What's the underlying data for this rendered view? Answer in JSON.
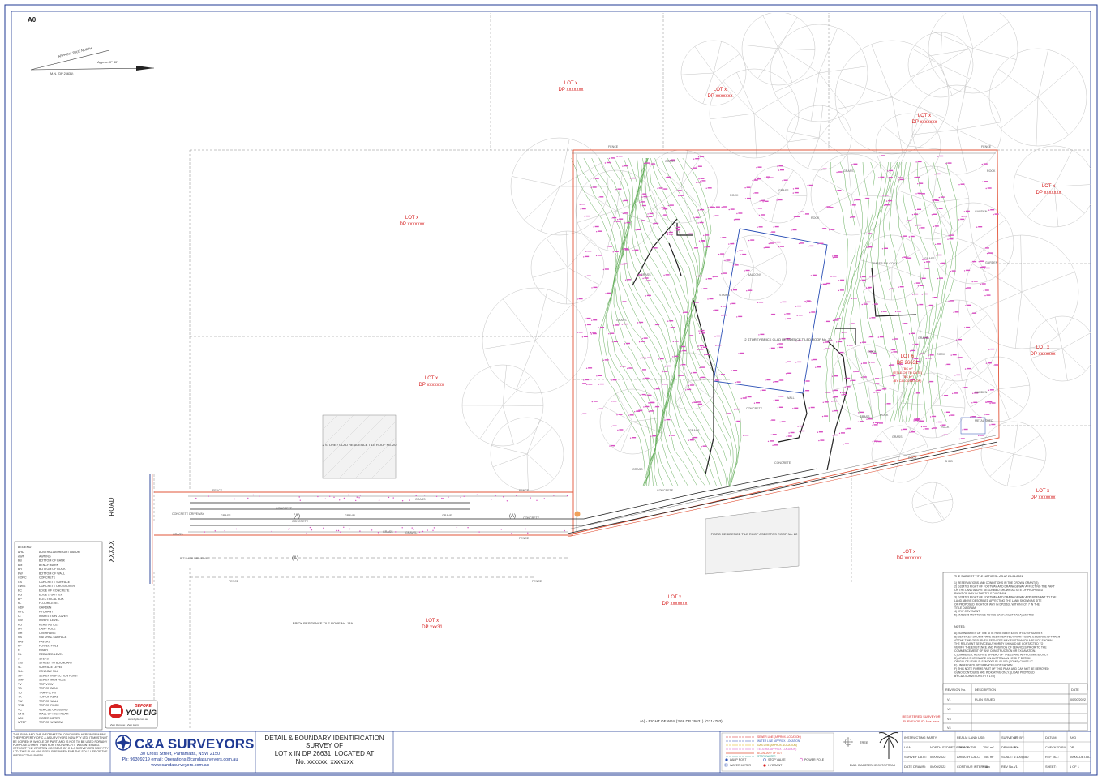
{
  "sheet": {
    "size_label": "A0",
    "north_label": "APPROX. TRUE NORTH",
    "north_note": "Approx. 0° 30'",
    "mgn_label": "M.N. (DP 26631)"
  },
  "road": {
    "name_top": "ROAD",
    "name_side": "XXXXX"
  },
  "lots": [
    {
      "lot": "LOT x",
      "dp": "DP xxxxxxx"
    },
    {
      "lot": "LOT x",
      "dp": "DP xxxxxxx"
    },
    {
      "lot": "LOT x",
      "dp": "DP xxxxxxx"
    },
    {
      "lot": "LOT x",
      "dp": "DP xxxxxxx"
    },
    {
      "lot": "LOT x",
      "dp": "DP xxxxxxx"
    },
    {
      "lot": "LOT x",
      "dp": "DP xxxxxxx"
    },
    {
      "lot": "LOT x",
      "dp": "DP xxxxxxx"
    },
    {
      "lot": "LOT x",
      "dp": "DP xxxxxxx"
    },
    {
      "lot": "LOT x",
      "dp": "DP xxxxxxx"
    },
    {
      "lot": "LOT x",
      "dp": "DP xxx31"
    }
  ],
  "subject_lot": {
    "lot": "LOT 6",
    "dp": "DP 26631",
    "area_line1": "TBC m²",
    "area_line2": "(TITLE OF TO DATE)",
    "area_line3": "TBC m²",
    "area_line4": "(BY CALCULATION)"
  },
  "map_labels": {
    "main_house": "2 STOREY BRICK CLAD RESIDENCE TILED ROOF No. 20",
    "west_house": "2 STOREY CLAD RESIDENCE TILE ROOF No. 20",
    "south_house": "BRICK RESIDENCE TILE ROOF No. 18A",
    "east_house": "FIBRO RESIDENCE TILE ROOF ASBESTOS ROOF No. 22",
    "gravel": "GRAVEL",
    "concrete": "CONCRETE",
    "grass": "GRASS",
    "fence": "FENCE",
    "rock": "ROCK",
    "stairs": "STAIRS",
    "wall": "WALL",
    "balcony": "BALCONY",
    "garden": "GARDEN",
    "shed": "SHED",
    "metal_shed": "METAL SHED",
    "timber_balcony": "TIMBER BALCONY",
    "concrete_driveway": "CONCRETE DRIVEWAY",
    "bitumen_driveway": "BITUMEN DRIVEWAY",
    "row_a": "(A)",
    "row_note": "(A) - RIGHT OF WAY (3.66 DP 26631) (G314703)"
  },
  "legend": {
    "title": "LEGEND",
    "rows": [
      [
        "AHD",
        "AUSTRALIAN HEIGHT DATUM"
      ],
      [
        "AWN",
        "AWNING"
      ],
      [
        "BB",
        "BOTTOM OF BANK"
      ],
      [
        "BM",
        "BENCH MARK"
      ],
      [
        "BR",
        "BOTTOM OF ROCK"
      ],
      [
        "BW",
        "BOTTOM OF WALL"
      ],
      [
        "CONC",
        "CONCRETE"
      ],
      [
        "CS",
        "CONCRETE SURFACE"
      ],
      [
        "CW/S",
        "CONCRETE CROSSOVER"
      ],
      [
        "EC",
        "EDGE OF CONCRETE"
      ],
      [
        "EG",
        "EDGE & GUTTER"
      ],
      [
        "EP",
        "ELECTRICAL BOX"
      ],
      [
        "FL",
        "FLOOR LEVEL"
      ],
      [
        "GDN",
        "GARDEN"
      ],
      [
        "HYD",
        "HYDRANT"
      ],
      [
        "IC",
        "INSPECTION COVER"
      ],
      [
        "INV",
        "INVERT LEVEL"
      ],
      [
        "KO",
        "KERB OUTLET"
      ],
      [
        "LH",
        "LAMP HOLE"
      ],
      [
        "OH",
        "OVERHANG"
      ],
      [
        "NS",
        "NATURAL SURFACE"
      ],
      [
        "PAV",
        "PAVERS"
      ],
      [
        "PP",
        "POWER POLE"
      ],
      [
        "R",
        "RISER"
      ],
      [
        "RL",
        "REDUCED LEVEL"
      ],
      [
        "S",
        "STEPS"
      ],
      [
        "S.B",
        "STREET TO BOUNDARY"
      ],
      [
        "SL",
        "SURFACE LEVEL"
      ],
      [
        "SLL",
        "WINDOW SILL"
      ],
      [
        "SIP",
        "SEWER INSPECTION POINT"
      ],
      [
        "SMH",
        "SEWER MAN HOLE"
      ],
      [
        "TV",
        "TOP VIEW"
      ],
      [
        "TB",
        "TOP OF BANK"
      ],
      [
        "TD",
        "TRAFFIC PIT"
      ],
      [
        "TK",
        "TOP OF KERB"
      ],
      [
        "TW",
        "TOP OF WALL"
      ],
      [
        "TRB",
        "TOP OF ROCK"
      ],
      [
        "VC",
        "VEHICLE CROSSING"
      ],
      [
        "WHB",
        "WALL OF HIGH NEAR"
      ],
      [
        "WM",
        "WATER METER"
      ],
      [
        "WTDP",
        "TOP OF WINDOW"
      ]
    ]
  },
  "notes": {
    "title_notes_header": "THE SUBJECT TITLE NOTICES - AS AT 23-04-2021",
    "title_notes": [
      "1) RESERVATIONS AND CONDITIONS IN THE CROWN GRANT(S)",
      "2) G314703 RIGHT OF FOOTWAY AND DRAINAGEWAY AFFECTING THE PART",
      "   OF THE LAND ABOVE DESCRIBED SHOWN AS SITE OF PROPOSED",
      "   RIGHT OF WAY IN THE TITLE DIAGRAM",
      "3) G314703 RIGHT OF FOOTWAY AND DRAINAGEWAY APPURTENANT TO THE",
      "   LAND ABOVE DESCRIBED AFFECTING THE LAND SHOWN AS SITE",
      "   OF PROPOSED RIGHT OF WAY IN DP26631 WITHIN LOT 7 IN THE",
      "   TITLE DIAGRAM",
      "4) 0747 COVENANT",
      "5) AM12345 MORTGAGE TO ING BANK (AUSTRALIA) LIMITED"
    ],
    "notes_header": "NOTES:",
    "notes": [
      "A) BOUNDARIES OF THE SITE HAVE BEEN IDENTIFIED BY SURVEY.",
      "B) SERVICES SHOWN HAVE BEEN DERIVED FROM VISUAL EVIDENCE APPARENT",
      "   AT THE TIME OF SURVEY. SERVICES MAY EXIST WHICH ARE NOT SHOWN.",
      "   THE RELEVANT SERVICE AUTHORITY SHOULD BE CONTACTED TO",
      "   VERIFY THE EXISTENCE AND POSITION OF SERVICES PRIOR TO THE",
      "   COMMENCEMENT OF ANY CONSTRUCTION OR EXCAVATION.",
      "C) DIAMETER, HEIGHT & SPREAD OF TREES ARE APPROXIMATE ONLY.",
      "D) LEVELS SHOWN ARE ON AUSTRALIAN HEIGHT DATUM",
      "   ORIGIN OF LEVELS: SSM 0000 RL 00.000 (SCIMS) CLASS LC",
      "E) UNDERGROUND SERVICES NOT SHOWN",
      "F) THIS NOTE FORMS PART OF THIS PLAN AND CAN NOT BE REMOVED",
      "G) NO CONTOURS ARE INDICATIVE ONLY. (LIDAR PROVIDED",
      "   BY C&A SURVEYORS PTY LTD)"
    ]
  },
  "revisions": {
    "headers": [
      "REVISION No.",
      "DESCRIPTION",
      "DATE"
    ],
    "rows": [
      [
        "V1",
        "PLAN ISSUED",
        "00/00/2022"
      ],
      [
        "V2",
        "",
        ""
      ],
      [
        "V3",
        "",
        ""
      ],
      [
        "V4",
        "",
        ""
      ]
    ]
  },
  "surveyor_sig": {
    "line1": "REGISTERED SURVEYOR",
    "line2": "SURVEYOR ID: Nos. xxxx"
  },
  "byd": {
    "top": "BEFORE",
    "main": "YOU DIG",
    "url": "www.byda.com.au",
    "tag": "Zero Damage • Zero Harm"
  },
  "company": {
    "disclaimer": "THIS PLAN AND THE INFORMATION CONTAINED HEREIN REMAINS THE PROPERTY OF C & A SURVEYORS NSW PTY LTD. IT MUST NOT BE COPIED IN WHOLE OR PART. AND IS NOT TO BE USED FOR ANY PURPOSE OTHER THAN FOR THAT WHICH IT WAS INTENDED. WITHOUT THE WRITTEN CONSENT OF C & A SURVEYORS NSW PTY LTD. THIS PLAN HAS BEEN PREPARED FOR THE SOLE USE OF THE INSTRUCTING PARTY.",
    "name": "C&A SURVEYORS",
    "address": "30 Cross Street, Parramatta, NSW 2150",
    "phone": "Ph: 96309219 email: Operations@candasurveyors.com.au",
    "web": "www.candasurveyors.com.au"
  },
  "title_block": {
    "line1": "DETAIL & BOUNDARY IDENTIFICATION",
    "line2": "SURVEY OF",
    "line3": "LOT x IN DP 26631, LOCATED AT",
    "line4": "No. xxxxxx, xxxxxxx"
  },
  "services_legend": {
    "lines": [
      "SEWER LINE (APPROX. LOCATION)",
      "WATER LINE (APPROX. LOCATION)",
      "GAS LINE (APPROX. LOCATION)",
      "TELSTRA (APPROX. LOCATION)",
      "BOUNDARY OF LOT",
      "STORMWATER"
    ],
    "items": [
      {
        "name": "LAMP POST",
        "symbol": "lamp-post"
      },
      {
        "name": "STOP VALVE",
        "symbol": "stop-valve"
      },
      {
        "name": "POWER POLE",
        "symbol": "power-pole"
      },
      {
        "name": "WATER METER",
        "symbol": "water-meter"
      },
      {
        "name": "HYDRANT",
        "symbol": "hydrant"
      }
    ],
    "tree_label": "TREE",
    "tree_note": "DIAM. DIAMETER/HEIGHT/SPREAD"
  },
  "info_table": [
    [
      "INSTRUCTING PARTY:",
      "",
      "REALM LAND USE:",
      "",
      "SURVEYED BY:",
      "LP",
      "DATUM:",
      "AHD"
    ],
    [
      "LGA:",
      "NORTH SYDNEY COUNCIL",
      "AREA BY DP:",
      "TBC m²",
      "DRAWN BY:",
      "BJ",
      "CHECKED BY:",
      "DR"
    ],
    [
      "SURVEY DATE:",
      "00/00/2022",
      "AREA BY CALC:",
      "TBC m²",
      "SCALE:",
      "1:100@A0",
      "REF NO.:",
      "00000-DETAIL"
    ],
    [
      "DATE DRAWN:",
      "00/00/2022",
      "CONTOUR INTERVAL:",
      "0.5m",
      "REV No.:",
      "V1",
      "SHEET:",
      "1 OF 1"
    ]
  ],
  "colors": {
    "frame": "#1f3a93",
    "boundary": "#e2553a",
    "red_text": "#d61f1f",
    "contour": "#69b060",
    "level_pink": "#d84fc2",
    "tree_grey": "#bdbdbd",
    "building_blue": "#2a4fb5"
  }
}
